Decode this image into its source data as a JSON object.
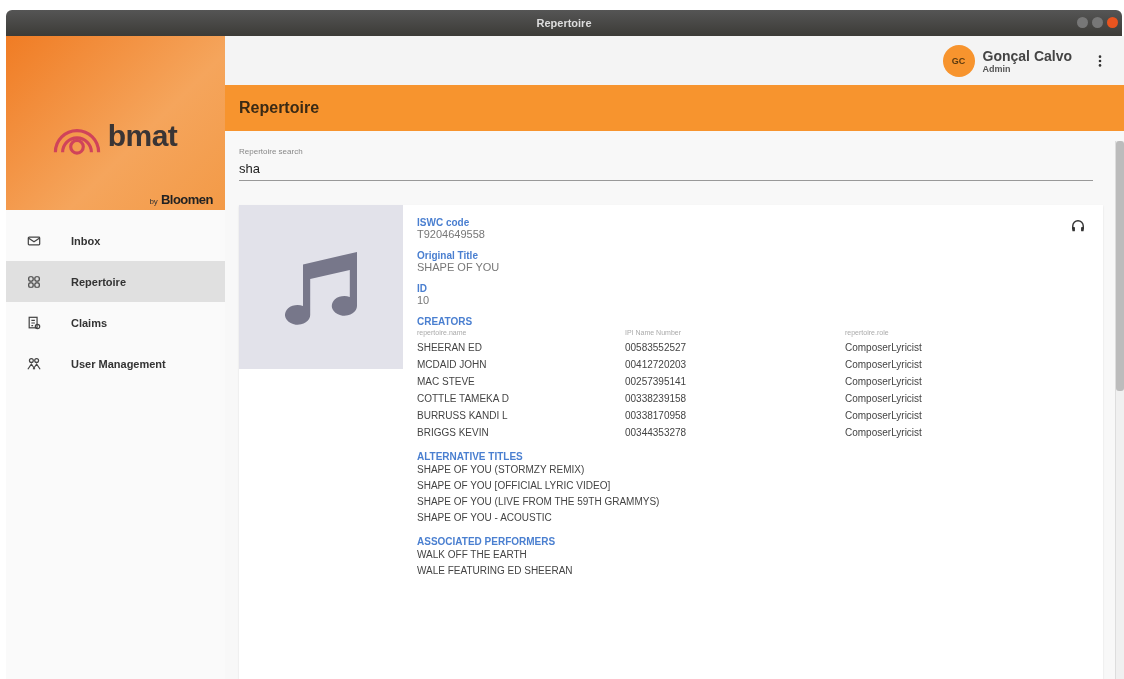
{
  "window": {
    "title": "Repertoire"
  },
  "brand": {
    "logo": "bmat",
    "byline": "by",
    "partner": "Bloomen"
  },
  "sidebar": {
    "items": [
      {
        "label": "Inbox",
        "selected": false
      },
      {
        "label": "Repertoire",
        "selected": true
      },
      {
        "label": "Claims",
        "selected": false
      },
      {
        "label": "User Management",
        "selected": false
      }
    ]
  },
  "user": {
    "initials": "GC",
    "name": "Gonçal Calvo",
    "role": "Admin"
  },
  "page_title": "Repertoire",
  "search": {
    "label": "Repertoire search",
    "value": "sha"
  },
  "work": {
    "fields": [
      {
        "label": "ISWC code",
        "value": "T9204649558"
      },
      {
        "label": "Original Title",
        "value": "SHAPE OF YOU"
      },
      {
        "label": "ID",
        "value": "10"
      }
    ],
    "creators": {
      "heading": "CREATORS",
      "columns": [
        "repertoire.name",
        "IPI Name Number",
        "repertoire.role"
      ],
      "rows": [
        [
          "SHEERAN ED",
          "00583552527",
          "ComposerLyricist"
        ],
        [
          "MCDAID JOHN",
          "00412720203",
          "ComposerLyricist"
        ],
        [
          "MAC STEVE",
          "00257395141",
          "ComposerLyricist"
        ],
        [
          "COTTLE TAMEKA D",
          "00338239158",
          "ComposerLyricist"
        ],
        [
          "BURRUSS KANDI L",
          "00338170958",
          "ComposerLyricist"
        ],
        [
          "BRIGGS KEVIN",
          "00344353278",
          "ComposerLyricist"
        ]
      ]
    },
    "alternative_titles": {
      "heading": "ALTERNATIVE TITLES",
      "items": [
        "SHAPE OF YOU (STORMZY REMIX)",
        "SHAPE OF YOU [OFFICIAL LYRIC VIDEO]",
        "SHAPE OF YOU (LIVE FROM THE 59TH GRAMMYS)",
        "SHAPE OF YOU - ACOUSTIC"
      ]
    },
    "performers": {
      "heading": "ASSOCIATED PERFORMERS",
      "items": [
        "WALK OFF THE EARTH",
        "WALE FEATURING ED SHEERAN"
      ]
    }
  }
}
